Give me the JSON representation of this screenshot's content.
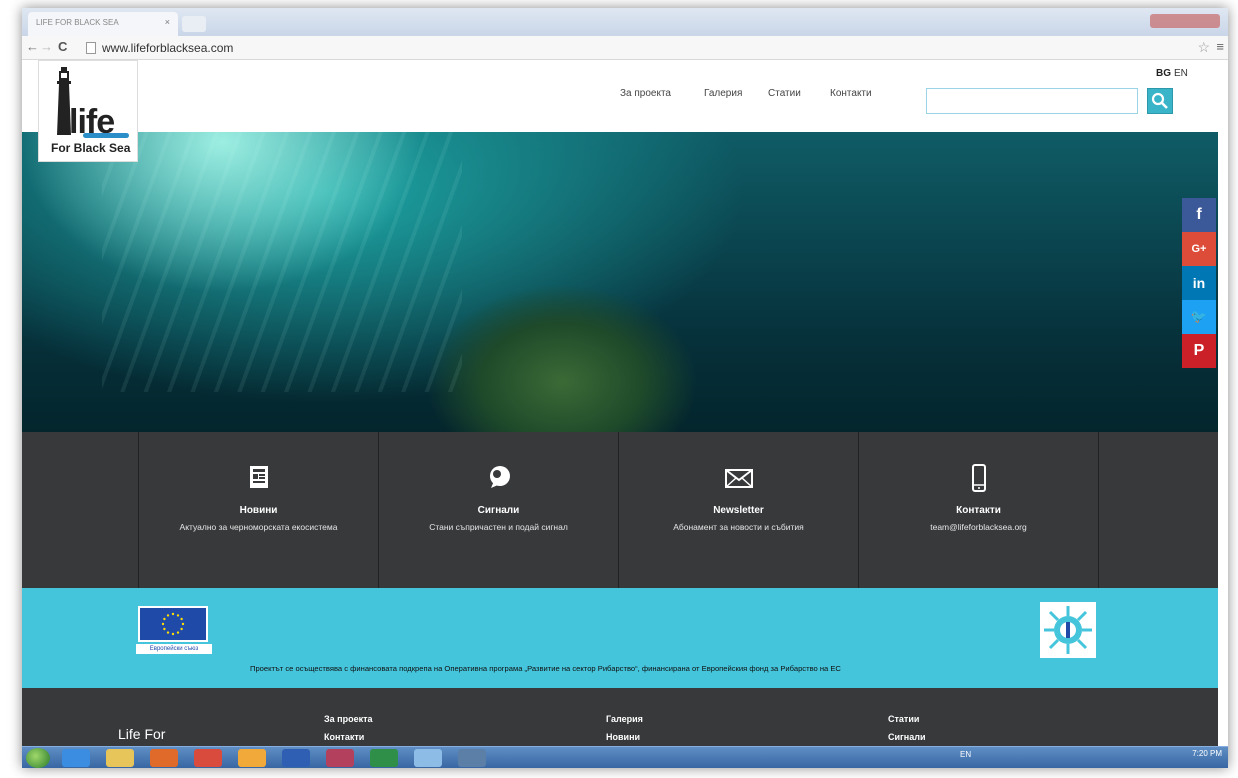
{
  "browser": {
    "tab_title": "LIFE FOR BLACK SEA",
    "tab_close": "×",
    "back": "←",
    "forward": "→",
    "reload": "C",
    "url": "www.lifeforblacksea.com",
    "star": "☆",
    "menu": "≡"
  },
  "logo": {
    "main": "life",
    "sub": "For Black Sea"
  },
  "nav": {
    "items": [
      "За проекта",
      "Галерия",
      "Статии",
      "Контакти"
    ]
  },
  "search": {
    "placeholder": ""
  },
  "lang": {
    "bg": "BG",
    "en": "EN"
  },
  "social": [
    {
      "name": "facebook",
      "glyph": "f",
      "color": "#3b5998"
    },
    {
      "name": "google-plus",
      "glyph": "G+",
      "color": "#dd4b39"
    },
    {
      "name": "linkedin",
      "glyph": "in",
      "color": "#0077b5"
    },
    {
      "name": "twitter",
      "glyph": "🐦",
      "color": "#1da1f2"
    },
    {
      "name": "pinterest",
      "glyph": "P",
      "color": "#cb2027"
    }
  ],
  "features": [
    {
      "icon": "newspaper-icon",
      "title": "Новини",
      "sub": "Актуално за черноморската екосистема"
    },
    {
      "icon": "chat-bubble-icon",
      "title": "Сигнали",
      "sub": "Стани съпричастен и подай сигнал"
    },
    {
      "icon": "envelope-icon",
      "title": "Newsletter",
      "sub": "Абонамент за новости и събития"
    },
    {
      "icon": "phone-icon",
      "title": "Контакти",
      "sub": "team@lifeforblacksea.org"
    }
  ],
  "funding": {
    "eu_label": "Европейски съюз",
    "text": "Проектът се осъществява с финансовата подкрепа на Оперативна програма „Развитие на сектор Рибарство“, финансирана от Европейския фонд за Рибарство на ЕС"
  },
  "footer": {
    "brand": "Life For",
    "col1": [
      "За проекта",
      "Контакти"
    ],
    "col2": [
      "Галерия",
      "Новини"
    ],
    "col3": [
      "Статии",
      "Сигнали"
    ]
  },
  "taskbar": {
    "lang": "EN",
    "time": "7:20 PM"
  },
  "colors": {
    "accent": "#44c5dc",
    "dark_band": "#37393b",
    "search_button": "#3ab4c8"
  }
}
